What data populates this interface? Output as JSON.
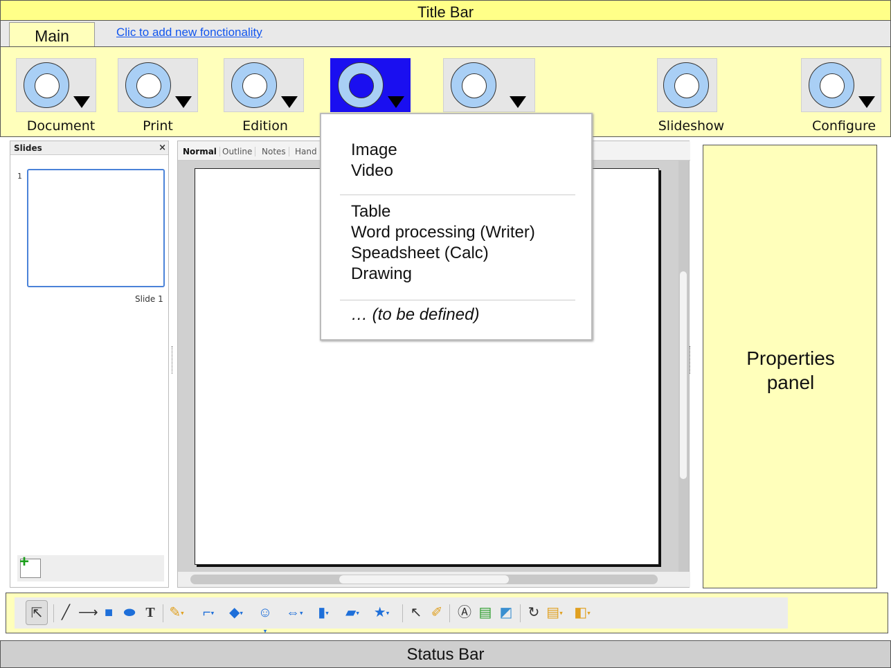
{
  "title_bar": {
    "label": "Title Bar"
  },
  "tabs": {
    "main_label": "Main",
    "add_link": "Clic to add new fonctionality"
  },
  "ribbon": {
    "buttons": [
      {
        "label": "Document",
        "has_dropdown": true,
        "active": false
      },
      {
        "label": "Print",
        "has_dropdown": true,
        "active": false
      },
      {
        "label": "Edition",
        "has_dropdown": true,
        "active": false
      },
      {
        "label": "",
        "has_dropdown": true,
        "active": true
      },
      {
        "label": "",
        "has_dropdown": true,
        "active": false
      },
      {
        "label": "Slideshow",
        "has_dropdown": false,
        "active": false
      },
      {
        "label": "Configure",
        "has_dropdown": true,
        "active": false
      }
    ],
    "active_color": "#1a0ff0",
    "icon_color": "#a9cff5"
  },
  "insert_menu": {
    "group1": [
      "Image",
      "Video"
    ],
    "group2": [
      "Table",
      "Word processing (Writer)",
      "Speadsheet (Calc)",
      "Drawing"
    ],
    "group3": [
      "… (to be defined)"
    ]
  },
  "slides_panel": {
    "title": "Slides",
    "close_icon": "×",
    "slides": [
      {
        "number": "1",
        "caption": "Slide 1"
      }
    ]
  },
  "view_tabs": [
    "Normal",
    "Outline",
    "Notes",
    "Hand"
  ],
  "properties_panel": {
    "label": "Properties\npanel"
  },
  "drawing_toolbar": {
    "tools": [
      "select-icon",
      "line-icon",
      "arrow-line-icon",
      "rectangle-icon",
      "ellipse-icon",
      "text-icon",
      "curve-icon",
      "connector-icon",
      "basic-shapes-icon",
      "symbol-shapes-icon",
      "block-arrows-icon",
      "flowchart-icon",
      "callouts-icon",
      "stars-icon",
      "points-icon",
      "glue-points-icon",
      "fontwork-icon",
      "from-file-icon",
      "gallery-icon",
      "rotate-icon",
      "alignment-icon",
      "arrange-icon"
    ]
  },
  "status_bar": {
    "label": "Status Bar"
  },
  "colors": {
    "panel_yellow": "#ffffbb",
    "title_yellow": "#ffff88",
    "link_blue": "#1155ee"
  }
}
